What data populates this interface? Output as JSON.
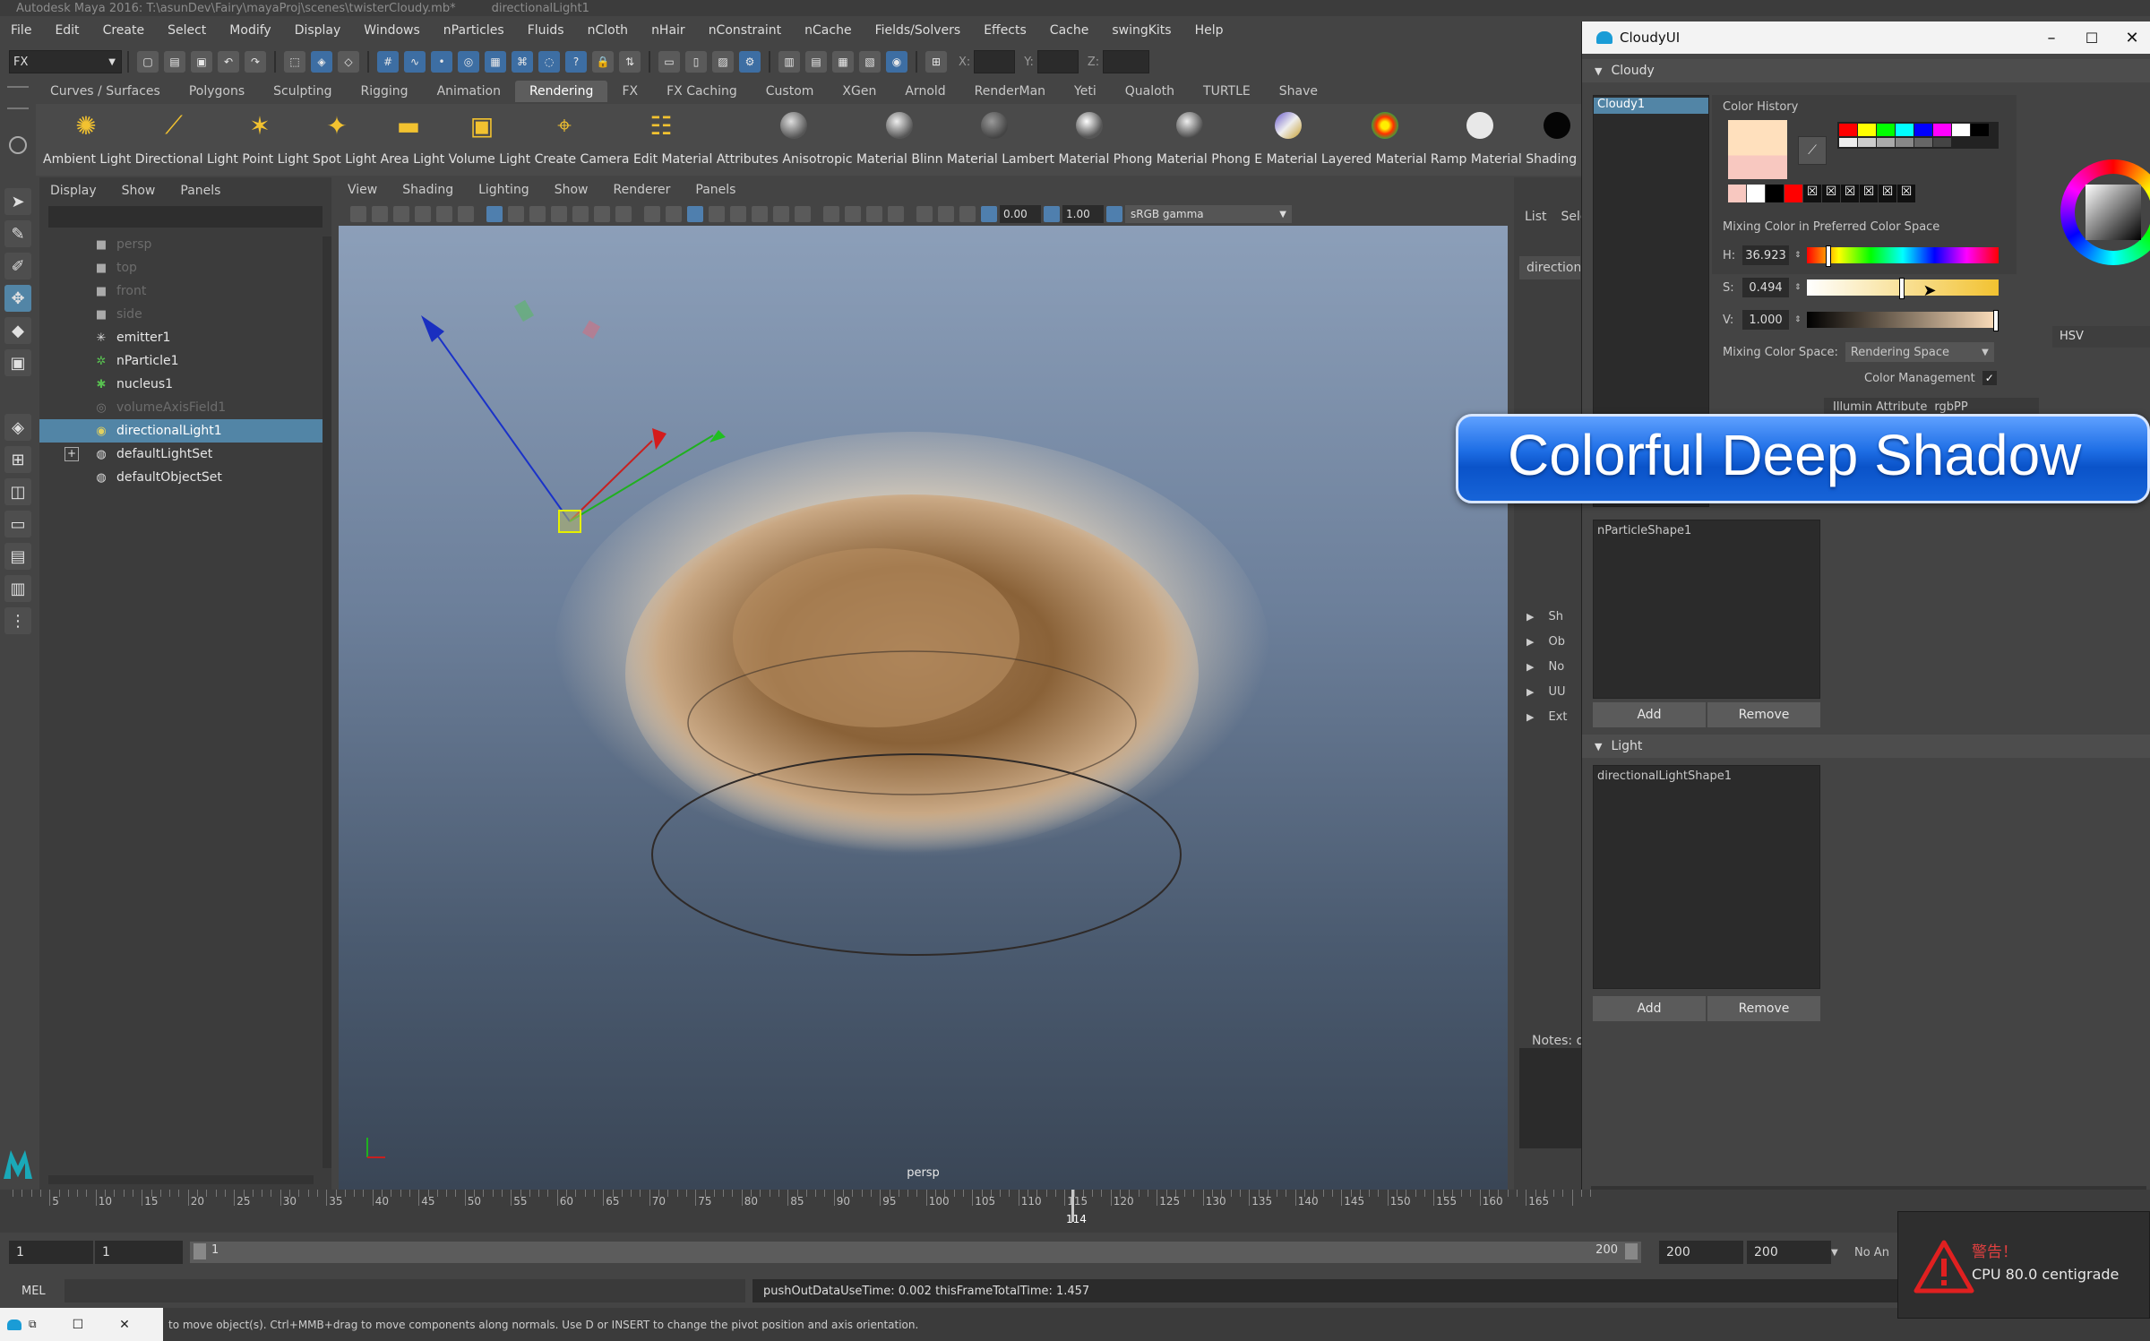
{
  "window": {
    "title": "Autodesk Maya 2016: T:\\asunDev\\Fairy\\mayaProj\\scenes\\twisterCloudy.mb*",
    "selection_title": "directionalLight1"
  },
  "menubar": [
    "File",
    "Edit",
    "Create",
    "Select",
    "Modify",
    "Display",
    "Windows",
    "nParticles",
    "Fluids",
    "nCloth",
    "nHair",
    "nConstraint",
    "nCache",
    "Fields/Solvers",
    "Effects",
    "Cache",
    "swingKits",
    "Help"
  ],
  "statusline": {
    "menuset": "FX",
    "x_label": "X:",
    "y_label": "Y:",
    "z_label": "Z:"
  },
  "shelf": {
    "tabs": [
      "Curves / Surfaces",
      "Polygons",
      "Sculpting",
      "Rigging",
      "Animation",
      "Rendering",
      "FX",
      "FX Caching",
      "Custom",
      "XGen",
      "Arnold",
      "RenderMan",
      "Yeti",
      "Qualoth",
      "TURTLE",
      "Shave"
    ],
    "active_tab": "Rendering",
    "labels_text": "Ambient Light Directional Light Point Light Spot Light Area Light Volume Light Create Camera Edit Material Attributes Anisotropic Material Blinn Material Lambert Material Phong Material Phong E Material Layered Material Ramp Material Shading Map Surface Ma",
    "icons": [
      "ambient-light",
      "directional-light",
      "point-light",
      "spot-light",
      "area-light",
      "volume-light",
      "camera",
      "material-attributes",
      "anisotropic",
      "blinn",
      "lambert",
      "phong",
      "phong-e",
      "layered",
      "ramp",
      "shading-map",
      "surface"
    ]
  },
  "outliner": {
    "menu": [
      "Display",
      "Show",
      "Panels"
    ],
    "items": [
      {
        "label": "persp",
        "icon": "camera-icon",
        "dim": true
      },
      {
        "label": "top",
        "icon": "camera-icon",
        "dim": true
      },
      {
        "label": "front",
        "icon": "camera-icon",
        "dim": true
      },
      {
        "label": "side",
        "icon": "camera-icon",
        "dim": true
      },
      {
        "label": "emitter1",
        "icon": "emitter-icon",
        "dim": false
      },
      {
        "label": "nParticle1",
        "icon": "particle-icon",
        "dim": false
      },
      {
        "label": "nucleus1",
        "icon": "nucleus-icon",
        "dim": false
      },
      {
        "label": "volumeAxisField1",
        "icon": "field-icon",
        "dim": true
      },
      {
        "label": "directionalLight1",
        "icon": "light-icon",
        "dim": false,
        "selected": true
      },
      {
        "label": "defaultLightSet",
        "icon": "set-icon",
        "dim": false,
        "expandable": true
      },
      {
        "label": "defaultObjectSet",
        "icon": "set-icon",
        "dim": false
      }
    ]
  },
  "viewport": {
    "menu": [
      "View",
      "Shading",
      "Lighting",
      "Show",
      "Renderer",
      "Panels"
    ],
    "near_value": "0.00",
    "far_value": "1.00",
    "color_space": "sRGB gamma",
    "camera_label": "persp"
  },
  "attribute_editor": {
    "tabs": [
      "List",
      "Sele"
    ],
    "node_tab": "direction",
    "sections": [
      "Sh",
      "Ob",
      "No",
      "UU",
      "Ext"
    ],
    "notes_label": "Notes: d"
  },
  "cloudy": {
    "window_title": "CloudyUI",
    "section_cloudy": "Cloudy",
    "cloudy_list": [
      "Cloudy1"
    ],
    "color_history_label": "Color History",
    "mixing_label": "Mixing Color in Preferred Color Space",
    "h_label": "H:",
    "h_value": "36.923",
    "s_label": "S:",
    "s_value": "0.494",
    "v_label": "V:",
    "v_value": "1.000",
    "hue_fraction": 0.1026,
    "sat_fraction": 0.494,
    "mixing_space_label": "Mixing Color Space:",
    "mixing_space_value": "Rendering Space",
    "color_management_label": "Color Management",
    "color_management_checked": true,
    "hsv_label": "HSV",
    "illumin_label": "Illumin Attribute",
    "illumin_value": "rgbPP",
    "particle_list": [
      "nParticleShape1"
    ],
    "add_label": "Add",
    "remove_label": "Remove",
    "section_light": "Light",
    "light_list": [
      "directionalLightShape1"
    ],
    "current_color": "#ffe0bd",
    "swatch_colors": [
      "#ff0000",
      "#ffff00",
      "#00ff00",
      "#00ffff",
      "#0000ff",
      "#ff00ff",
      "#ffffff",
      "#000000"
    ]
  },
  "banner": {
    "text": "Colorful Deep Shadow"
  },
  "timeline": {
    "ticks": [
      "5",
      "10",
      "15",
      "20",
      "25",
      "30",
      "35",
      "40",
      "45",
      "50",
      "55",
      "60",
      "65",
      "70",
      "75",
      "80",
      "85",
      "90",
      "95",
      "100",
      "105",
      "110",
      "115",
      "120",
      "125",
      "130",
      "135",
      "140",
      "145",
      "150",
      "155",
      "160",
      "165"
    ],
    "current_frame": "114"
  },
  "range": {
    "start": "1",
    "playback_start": "1",
    "slider_start": "1",
    "slider_end": "200",
    "playback_end": "200",
    "end": "200",
    "anim_layer": "No An"
  },
  "cmdline": {
    "mel_label": "MEL",
    "result": "pushOutDataUseTime: 0.002 thisFrameTotalTime: 1.457"
  },
  "helpline": {
    "text": "to move object(s). Ctrl+MMB+drag to move components along normals. Use D or INSERT to change the pivot position and axis orientation."
  },
  "warning": {
    "title": "警告！",
    "message": "CPU 80.0 centigrade"
  }
}
